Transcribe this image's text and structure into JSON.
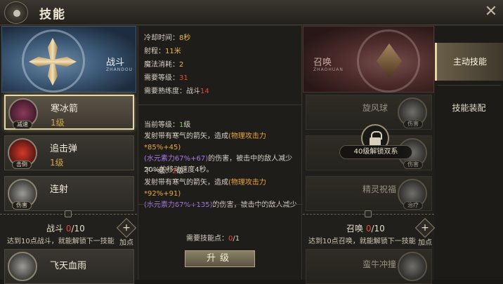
{
  "header": {
    "title": "技能"
  },
  "left": {
    "banner_label": "战斗",
    "banner_sub": "ZHANDOU",
    "skills": [
      {
        "name": "寒冰箭",
        "level": "1级",
        "tag": "减速",
        "selected": true
      },
      {
        "name": "追击弹",
        "level": "1级",
        "tag": "击倒"
      },
      {
        "name": "连射",
        "level": "",
        "tag": "伤害"
      },
      {
        "name": "飞天血雨",
        "level": "",
        "tag": ""
      }
    ],
    "category": {
      "name": "战斗",
      "current": "0",
      "max": "/10"
    },
    "unlock_hint": "达到10点战斗，就能解锁下一技能",
    "add_point": "加点"
  },
  "detail": {
    "cooldown_label": "冷却时间：",
    "cooldown_value": "8秒",
    "range_label": "射程：",
    "range_value": "11米",
    "mana_label": "魔法消耗：",
    "mana_value": "2",
    "req_level_label": "需要等级：",
    "req_level_value": "31",
    "req_prof_label": "需要熟练度：",
    "req_prof_name": "战斗",
    "req_prof_value": "14",
    "current_level_label": "当前等级：",
    "current_level_value": "1",
    "current_level_unit": "级",
    "current_desc_1": "发射带有寒气的箭矢，造成",
    "current_phys": "(物理攻击力*85%+45)",
    "current_elem": "(水元素力67%+67)",
    "current_desc_2": "的伤害，被击中的敌人减少20%的移动速度4秒。",
    "next_level_label": "下一级：",
    "next_level_value": "2",
    "next_level_unit": "级",
    "next_desc_1": "发射带有寒气的箭矢，造成",
    "next_phys": "(物理攻击力*92%+91)",
    "next_elem": "(水元素力67%+135)",
    "next_desc_2": "的伤害，被击中的敌人减少",
    "req_points_label": "需要技能点：",
    "req_points_cur": "0",
    "req_points_max": "/1",
    "upgrade_label": "升级"
  },
  "right": {
    "banner_label": "召唤",
    "banner_sub": "ZHAOHUAN",
    "skills": [
      {
        "name": "旋风球",
        "tag": "伤害"
      },
      {
        "name": "",
        "tag": "伤害"
      },
      {
        "name": "精灵祝福",
        "tag": "治疗"
      },
      {
        "name": "蛮牛冲撞",
        "tag": ""
      }
    ],
    "lock_text": "40级解锁双系",
    "category": {
      "name": "召唤",
      "current": "0",
      "max": "/10"
    },
    "unlock_hint": "达到10点召唤，就能解锁下一技能",
    "add_point": "加点"
  },
  "tabs": [
    {
      "label": "主动技能",
      "active": true
    },
    {
      "label": "技能装配",
      "active": false
    }
  ]
}
